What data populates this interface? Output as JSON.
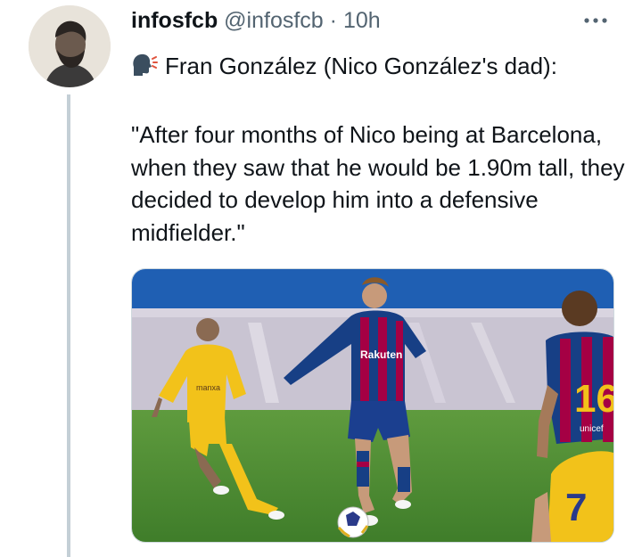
{
  "tweet": {
    "display_name": "infosfcb",
    "handle": "@infosfcb",
    "separator": "·",
    "timestamp": "10h",
    "more_icon": "more-horizontal-icon",
    "speaker_emoji": "speaking-head-emoji",
    "lines": {
      "attribution": "Fran González (Nico González's dad):",
      "quote": "\"After four months of Nico being at Barcelona, when they saw that he would be 1.90m tall, they decided to develop him into a defensive midfielder.\""
    }
  },
  "media": {
    "kit_text": {
      "sponsor": "Rakuten",
      "opponent_sponsor": "manxa",
      "number_right": "16",
      "number_bottom": "7",
      "back_brand": "unicef"
    }
  }
}
